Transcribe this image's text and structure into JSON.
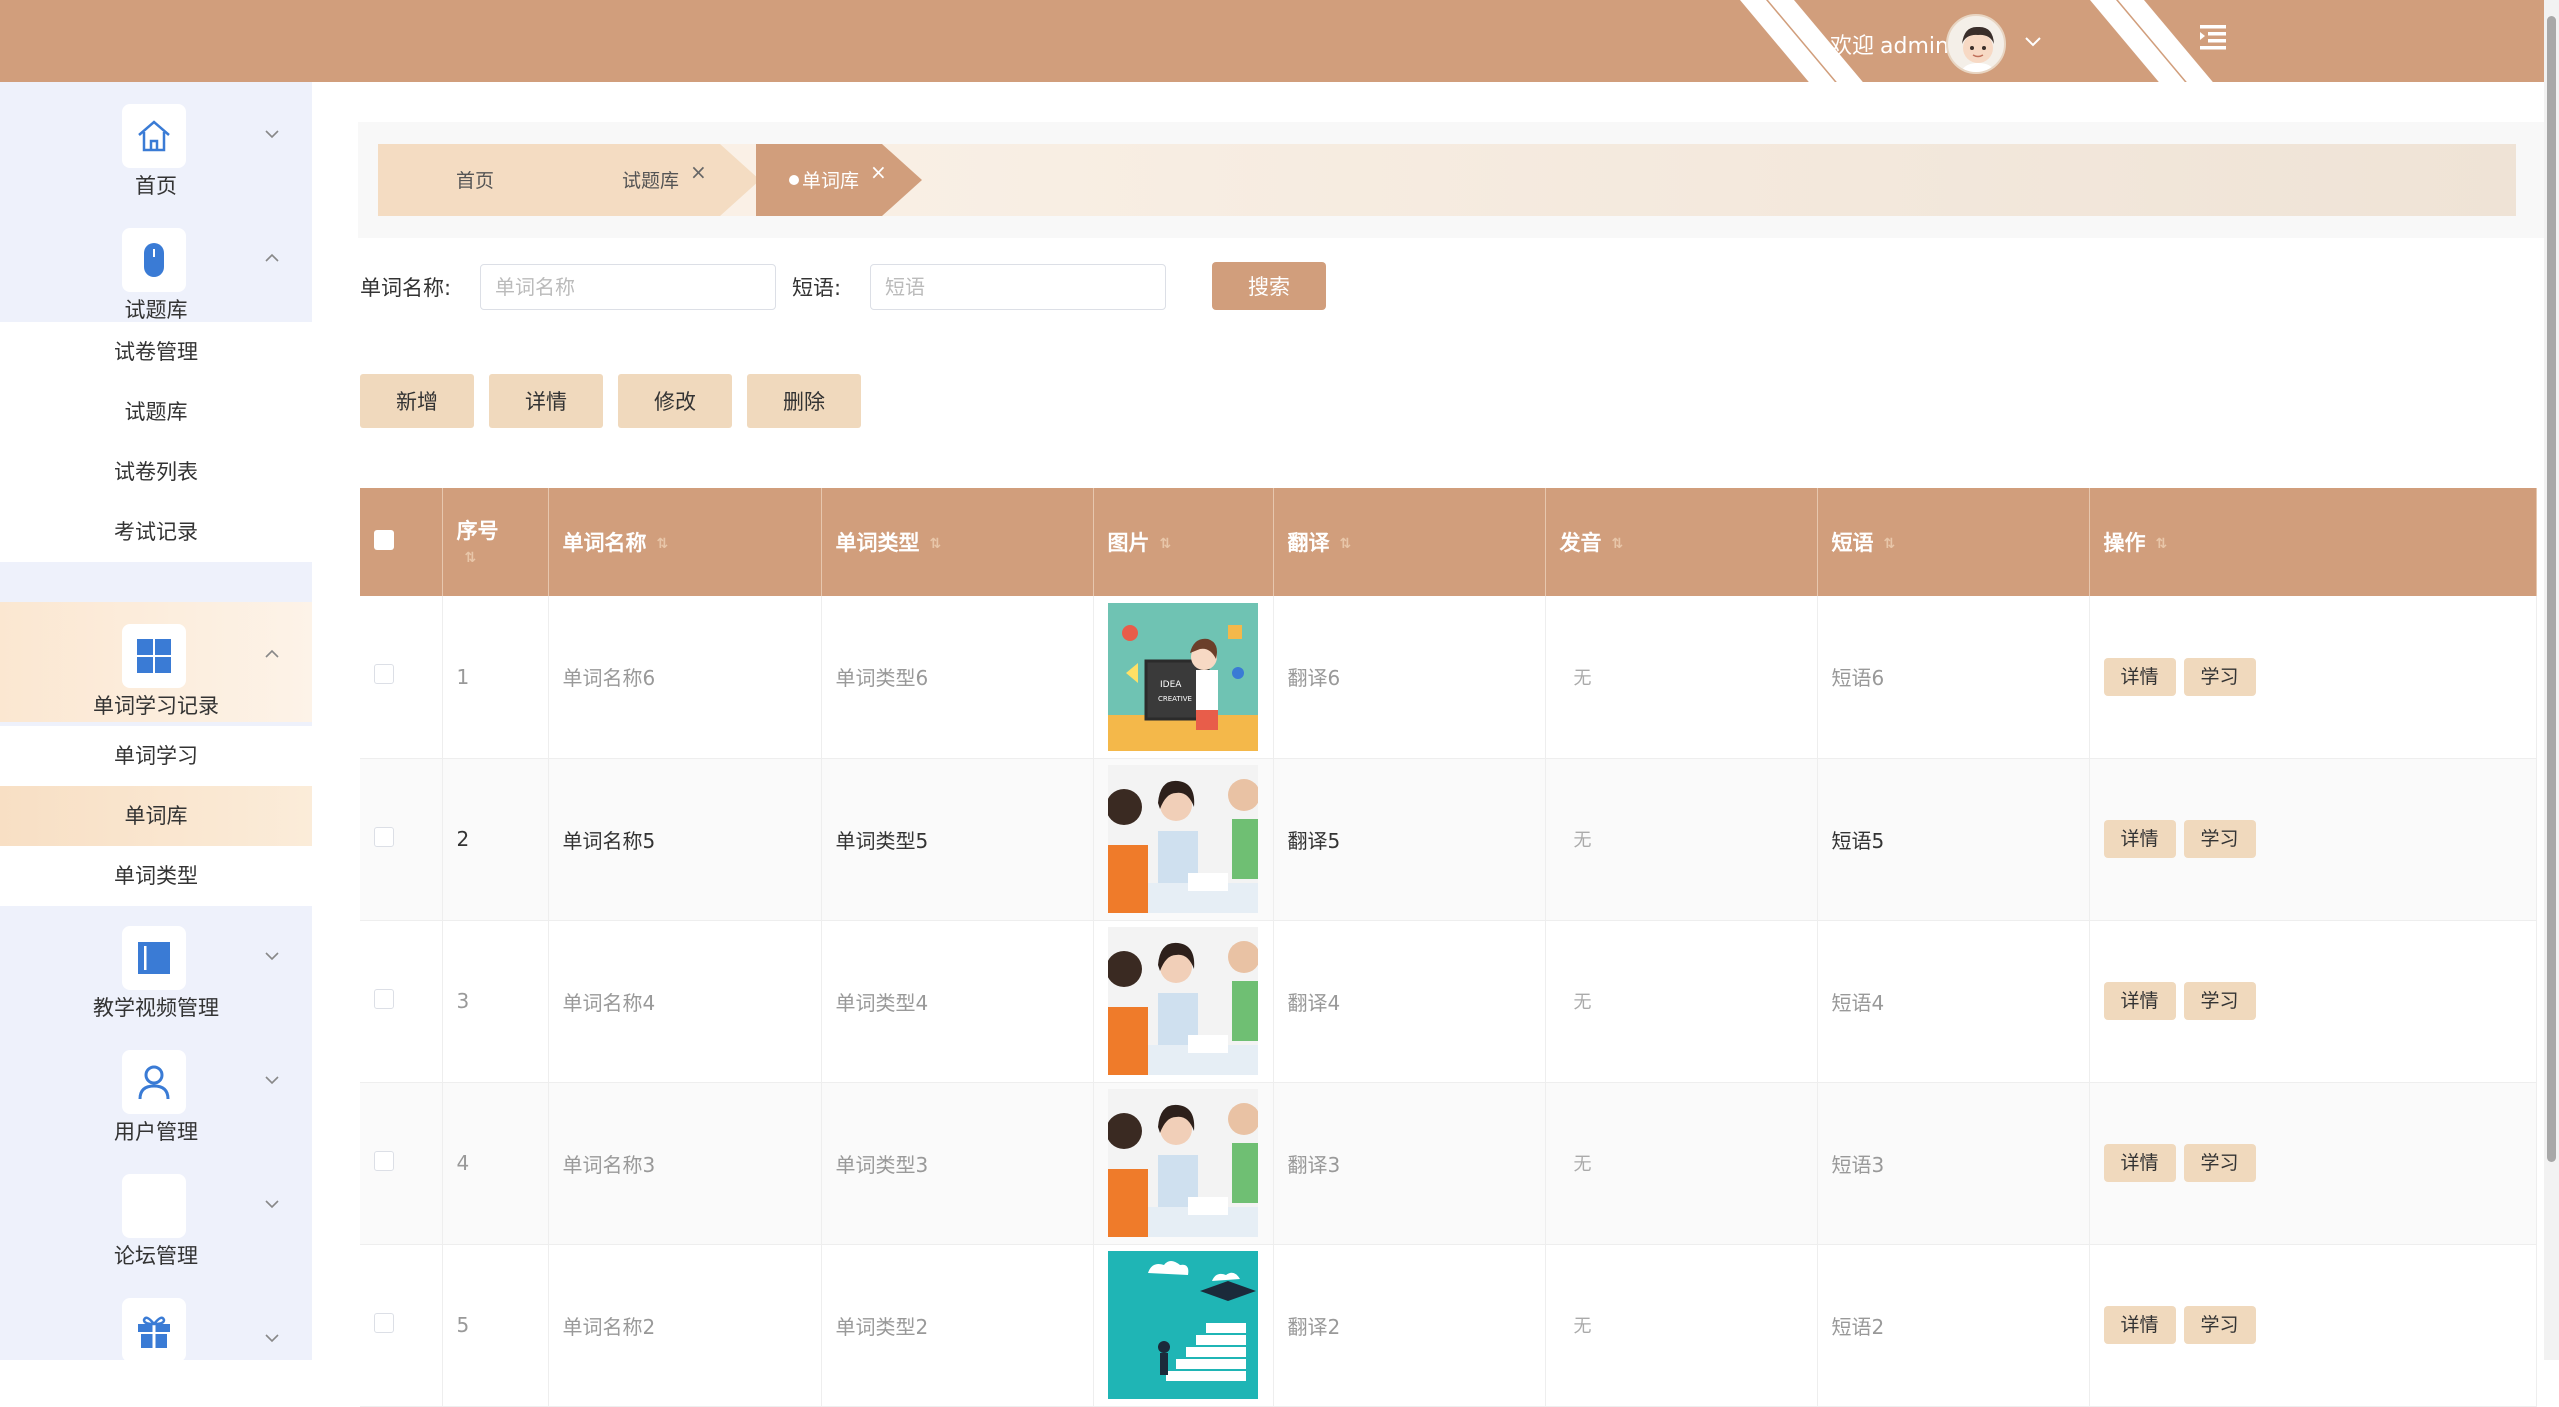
{
  "header": {
    "welcome": "欢迎",
    "username": "admin"
  },
  "sidebar": {
    "groups": [
      {
        "label": "首页",
        "icon": "home-icon"
      },
      {
        "label": "试题库",
        "icon": "mouse-icon",
        "items": [
          "试卷管理",
          "试题库",
          "试卷列表",
          "考试记录"
        ]
      },
      {
        "label": "单词学习记录",
        "icon": "windows-grid-icon",
        "items": [
          "单词学习",
          "单词库",
          "单词类型"
        ]
      },
      {
        "label": "教学视频管理",
        "icon": "book-icon"
      },
      {
        "label": "用户管理",
        "icon": "user-icon"
      },
      {
        "label": "论坛管理",
        "icon": "forum-icon"
      },
      {
        "label": "",
        "icon": "gift-icon"
      }
    ],
    "active_item": "单词库"
  },
  "tabs": [
    {
      "label": "首页"
    },
    {
      "label": "试题库",
      "close": "×"
    },
    {
      "label": "单词库",
      "close": "×"
    }
  ],
  "search": {
    "word_label": "单词名称:",
    "word_placeholder": "单词名称",
    "phrase_label": "短语:",
    "phrase_placeholder": "短语",
    "button": "搜索"
  },
  "actions": {
    "add": "新增",
    "detail": "详情",
    "edit": "修改",
    "delete": "删除"
  },
  "table": {
    "columns": [
      "序号",
      "单词名称",
      "单词类型",
      "图片",
      "翻译",
      "发音",
      "短语",
      "操作"
    ],
    "rows": [
      {
        "index": "1",
        "name": "单词名称6",
        "type": "单词类型6",
        "image": "teacher-board-image",
        "translation": "翻译6",
        "pronunciation": "无",
        "phrase": "短语6"
      },
      {
        "index": "2",
        "name": "单词名称5",
        "type": "单词类型5",
        "image": "tutoring-image",
        "translation": "翻译5",
        "pronunciation": "无",
        "phrase": "短语5"
      },
      {
        "index": "3",
        "name": "单词名称4",
        "type": "单词类型4",
        "image": "tutoring-image",
        "translation": "翻译4",
        "pronunciation": "无",
        "phrase": "短语4"
      },
      {
        "index": "4",
        "name": "单词名称3",
        "type": "单词类型3",
        "image": "tutoring-image",
        "translation": "翻译3",
        "pronunciation": "无",
        "phrase": "短语3"
      },
      {
        "index": "5",
        "name": "单词名称2",
        "type": "单词类型2",
        "image": "graduation-stairs-image",
        "translation": "翻译2",
        "pronunciation": "无",
        "phrase": "短语2"
      }
    ],
    "row_buttons": {
      "detail": "详情",
      "study": "学习"
    }
  },
  "colors": {
    "brand": "#d19e7c",
    "button_light": "#f0d9bd",
    "sidebar_bg": "#eef1fb",
    "icon_blue": "#3a7bd5"
  }
}
